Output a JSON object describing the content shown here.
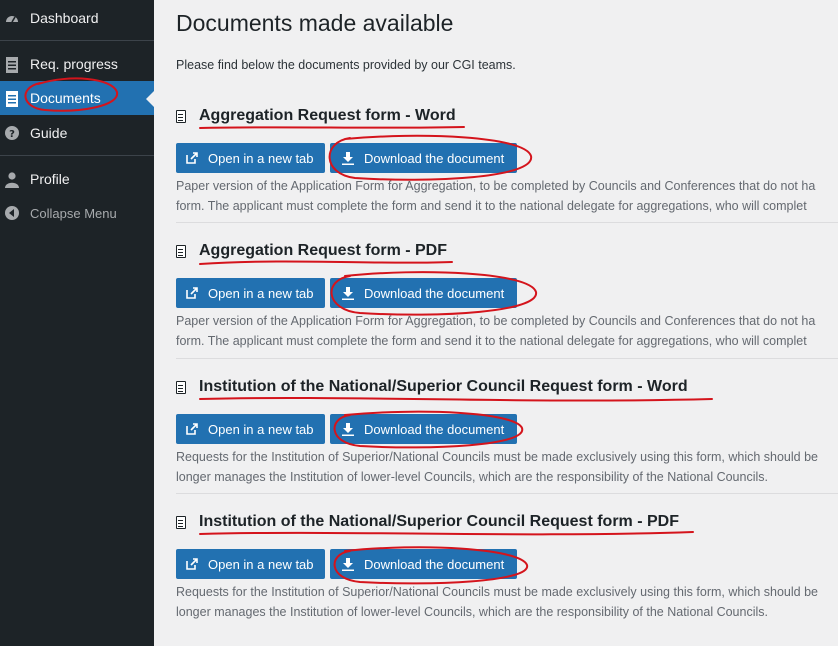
{
  "sidebar": {
    "items": [
      {
        "label": "Dashboard",
        "icon": "dashboard-icon"
      },
      {
        "label": "Req. progress",
        "icon": "clipboard-icon"
      },
      {
        "label": "Documents",
        "icon": "document-icon"
      },
      {
        "label": "Guide",
        "icon": "question-icon"
      },
      {
        "label": "Profile",
        "icon": "user-icon"
      },
      {
        "label": "Collapse Menu",
        "icon": "collapse-icon"
      }
    ],
    "active_index": 2
  },
  "main": {
    "title": "Documents made available",
    "intro": "Please find below the documents provided by our CGI teams.",
    "open_label": "Open in a new tab",
    "download_label": "Download the document",
    "documents": [
      {
        "title": "Aggregation Request form - Word",
        "desc_line1": "Paper version of the Application Form for Aggregation, to be completed by Councils and Conferences that do not ha",
        "desc_line2": "form. The applicant must complete the form and send it to the national delegate for aggregations, who will complet"
      },
      {
        "title": "Aggregation Request form - PDF",
        "desc_line1": "Paper version of the Application Form for Aggregation, to be completed by Councils and Conferences that do not ha",
        "desc_line2": "form. The applicant must complete the form and send it to the national delegate for aggregations, who will complet"
      },
      {
        "title": "Institution of the National/Superior Council Request form - Word",
        "desc_line1": "Requests for the Institution of Superior/National Councils must be made exclusively using this form, which should be",
        "desc_line2": "longer manages the Institution of lower-level Councils, which are the responsibility of the National Councils."
      },
      {
        "title": "Institution of the National/Superior Council Request form - PDF",
        "desc_line1": "Requests for the Institution of Superior/National Councils must be made exclusively using this form, which should be",
        "desc_line2": "longer manages the Institution of lower-level Councils, which are the responsibility of the National Councils."
      }
    ]
  },
  "colors": {
    "sidebar_bg": "#1d2327",
    "accent": "#2271b1",
    "annotation": "#d4141c"
  }
}
